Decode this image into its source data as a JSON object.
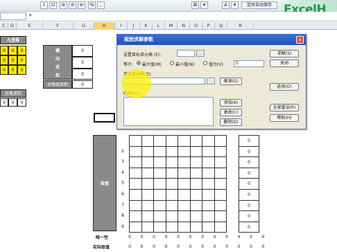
{
  "toolbar": {
    "buttons": [
      "I",
      "U",
      "≡",
      "≡",
      "≡",
      "%",
      ",",
      "⊞",
      "▾",
      "A",
      "▾"
    ],
    "custom_button": "定时自动保存",
    "logo": "ExcelH"
  },
  "columns": [
    "C",
    "D",
    "E",
    "F",
    "G",
    "H",
    "I",
    "J",
    "K",
    "L",
    "M",
    "N",
    "O",
    "P",
    "Q",
    "R"
  ],
  "left_panel": {
    "header": "九宫格",
    "yellow_values": [
      "0",
      "0",
      "0",
      "0",
      "0",
      "0",
      "0",
      "0",
      "0"
    ],
    "bottom_header": "对角求和",
    "bottom_values": [
      "0",
      "0",
      "0"
    ]
  },
  "mid_table": {
    "label_chars": [
      "横",
      "向",
      "求",
      "和"
    ],
    "diag_label": "对角线求和",
    "values": [
      "0",
      "0",
      "0",
      "0"
    ]
  },
  "main_grid": {
    "side_label": "取值",
    "row_numbers": [
      "2",
      "3",
      "4",
      "5",
      "6",
      "7",
      "8",
      "9"
    ],
    "right_values": [
      "0",
      "0",
      "0",
      "0",
      "0",
      "0",
      "0",
      "0",
      "0"
    ],
    "row_unique_label": "唯一性",
    "row_actual_label": "实际取值",
    "bottom_values": [
      "0",
      "0",
      "0",
      "0",
      "0",
      "0",
      "0",
      "0",
      "0",
      "0",
      "0",
      "0"
    ]
  },
  "dialog": {
    "title": "规划求解参数",
    "target_label": "设置目标单元格 (E):",
    "equal_label": "等于:",
    "radio_max": "最大值(M)",
    "radio_min": "最小值(N)",
    "radio_value": "值为(V)",
    "value_input": "0",
    "changing_label": "可变单元格(B):",
    "guess_button": "推测(G)",
    "constraints_label": "约束(U):",
    "add_button": "添加(A)",
    "change_button": "更改(C)",
    "delete_button": "删除(D)",
    "solve_button": "求解(S)",
    "close_button": "关闭",
    "options_button": "选项(O)",
    "reset_button": "全部重设(R)",
    "help_button": "帮助(H)",
    "close_icon": "×"
  }
}
